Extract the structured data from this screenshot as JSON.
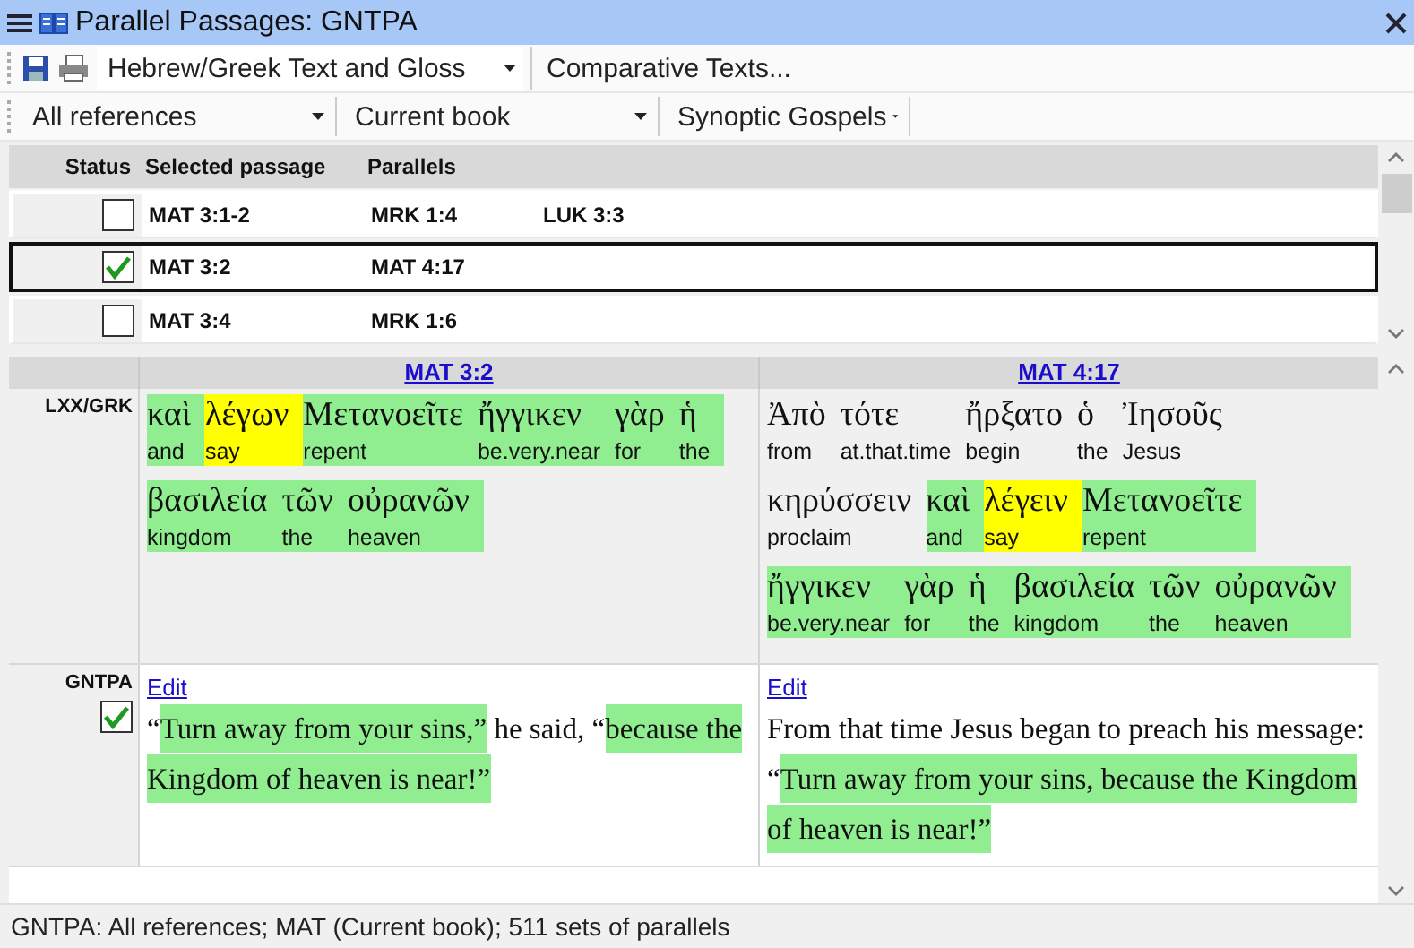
{
  "window": {
    "title": "Parallel Passages: GNTPA"
  },
  "toolbar": {
    "text_dropdown": "Hebrew/Greek Text and Gloss",
    "comparative": "Comparative Texts..."
  },
  "filters": [
    {
      "label": "All references"
    },
    {
      "label": "Current book"
    },
    {
      "label": "Synoptic Gospels"
    }
  ],
  "table": {
    "columns": [
      "Status",
      "Selected passage",
      "Parallels"
    ],
    "rows": [
      {
        "checked": false,
        "selected": false,
        "passage": "MAT 3:1-2",
        "parallels": [
          "MRK 1:4",
          "LUK 3:3"
        ]
      },
      {
        "checked": true,
        "selected": true,
        "passage": "MAT 3:2",
        "parallels": [
          "MAT 4:17"
        ]
      },
      {
        "checked": false,
        "selected": false,
        "passage": "MAT 3:4",
        "parallels": [
          "MRK 1:6"
        ]
      }
    ]
  },
  "compare": {
    "columns": [
      {
        "heading": "MAT 3:2",
        "greek_lines": [
          [
            {
              "greek": "καὶ",
              "gloss": "and",
              "color": "#90ee90"
            },
            {
              "greek": "λέγων",
              "gloss": "say",
              "color": "#ffff00"
            },
            {
              "greek": "Μετανοεῖτε",
              "gloss": "repent",
              "color": "#90ee90"
            },
            {
              "greek": "ἤγγικεν",
              "gloss": "be.very.near",
              "color": "#90ee90"
            },
            {
              "greek": "γὰρ",
              "gloss": "for",
              "color": "#90ee90"
            },
            {
              "greek": "ἡ",
              "gloss": "the",
              "color": "#90ee90"
            }
          ],
          [
            {
              "greek": "βασιλεία",
              "gloss": "kingdom",
              "color": "#90ee90"
            },
            {
              "greek": "τῶν",
              "gloss": "the",
              "color": "#90ee90"
            },
            {
              "greek": "οὐρανῶν",
              "gloss": "heaven",
              "color": "#90ee90"
            }
          ]
        ],
        "edit": "Edit",
        "text": [
          {
            "t": "“"
          },
          {
            "t": "Turn away from your sins,”",
            "color": "#90ee90"
          },
          {
            "t": " he said, “"
          },
          {
            "t": "because the Kingdom of heaven is near!”",
            "color": "#90ee90"
          }
        ]
      },
      {
        "heading": "MAT 4:17",
        "greek_lines": [
          [
            {
              "greek": "Ἀπὸ",
              "gloss": "from"
            },
            {
              "greek": "τότε",
              "gloss": "at.that.time"
            },
            {
              "greek": "ἤρξατο",
              "gloss": "begin"
            },
            {
              "greek": "ὁ",
              "gloss": "the"
            },
            {
              "greek": "Ἰησοῦς",
              "gloss": "Jesus"
            }
          ],
          [
            {
              "greek": "κηρύσσειν",
              "gloss": "proclaim"
            },
            {
              "greek": "καὶ",
              "gloss": "and",
              "color": "#90ee90"
            },
            {
              "greek": "λέγειν",
              "gloss": "say",
              "color": "#ffff00"
            },
            {
              "greek": "Μετανοεῖτε",
              "gloss": "repent",
              "color": "#90ee90"
            }
          ],
          [
            {
              "greek": "ἤγγικεν",
              "gloss": "be.very.near",
              "color": "#90ee90"
            },
            {
              "greek": "γὰρ",
              "gloss": "for",
              "color": "#90ee90"
            },
            {
              "greek": "ἡ",
              "gloss": "the",
              "color": "#90ee90"
            },
            {
              "greek": "βασιλεία",
              "gloss": "kingdom",
              "color": "#90ee90"
            },
            {
              "greek": "τῶν",
              "gloss": "the",
              "color": "#90ee90"
            },
            {
              "greek": "οὐρανῶν",
              "gloss": "heaven",
              "color": "#90ee90"
            }
          ]
        ],
        "edit": "Edit",
        "text": [
          {
            "t": "From that time Jesus began to preach his message: “"
          },
          {
            "t": "Turn away from your sins, because the Kingdom of heaven is near!”",
            "color": "#90ee90"
          }
        ]
      }
    ],
    "greek_label": "LXX/GRK",
    "version_label": "GNTPA",
    "version_checked": true
  },
  "status_bar": "GNTPA: All references; MAT (Current book); 511 sets of parallels"
}
